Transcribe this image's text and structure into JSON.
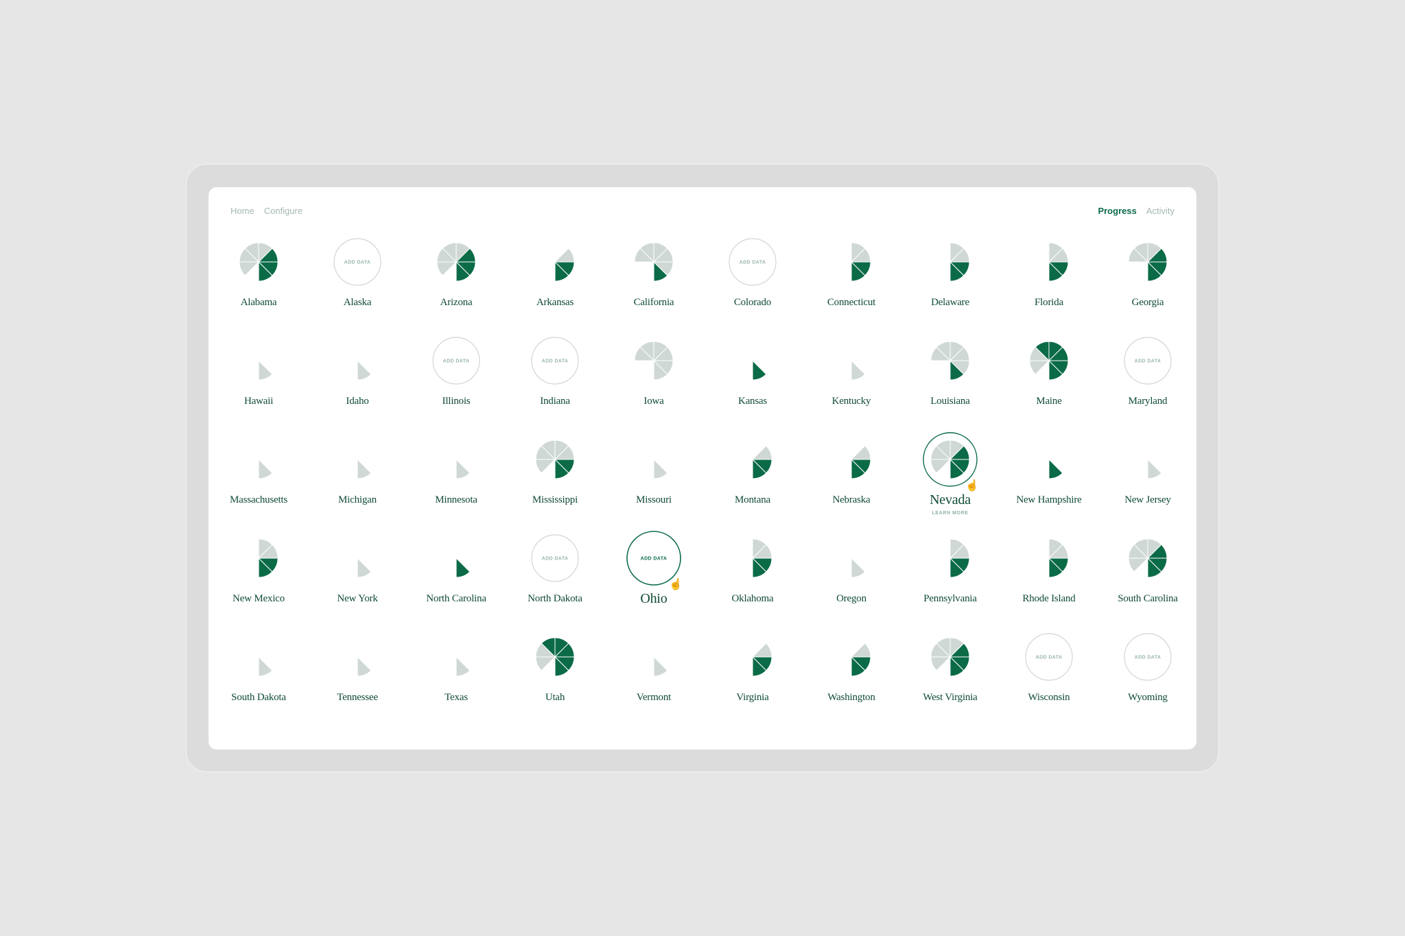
{
  "nav": {
    "left": [
      {
        "label": "Home",
        "active": false
      },
      {
        "label": "Configure",
        "active": false
      }
    ],
    "right": [
      {
        "label": "Progress",
        "active": true
      },
      {
        "label": "Activity",
        "active": false
      }
    ]
  },
  "colors": {
    "primary": "#0b6b47",
    "muted": "#cfd8d5",
    "text": "#0f4b33",
    "background": "#e6e6e6"
  },
  "add_data_label": "ADD DATA",
  "learn_more_label": "LEARN MORE",
  "chart_note": "Each state shows an 8-segment radial progress icon; muted = light grey, filled = green; null = no data (Add Data button)",
  "states": [
    {
      "name": "Alabama",
      "muted": 4,
      "filled": 3
    },
    {
      "name": "Alaska",
      "muted": null,
      "filled": null
    },
    {
      "name": "Arizona",
      "muted": 4,
      "filled": 3
    },
    {
      "name": "Arkansas",
      "muted": 1,
      "filled": 2
    },
    {
      "name": "California",
      "muted": 5,
      "filled": 1
    },
    {
      "name": "Colorado",
      "muted": null,
      "filled": null
    },
    {
      "name": "Connecticut",
      "muted": 2,
      "filled": 2
    },
    {
      "name": "Delaware",
      "muted": 2,
      "filled": 2
    },
    {
      "name": "Florida",
      "muted": 2,
      "filled": 2
    },
    {
      "name": "Georgia",
      "muted": 3,
      "filled": 3
    },
    {
      "name": "Hawaii",
      "muted": 1,
      "filled": 0
    },
    {
      "name": "Idaho",
      "muted": 1,
      "filled": 0
    },
    {
      "name": "Illinois",
      "muted": null,
      "filled": null
    },
    {
      "name": "Indiana",
      "muted": null,
      "filled": null
    },
    {
      "name": "Iowa",
      "muted": 6,
      "filled": 0
    },
    {
      "name": "Kansas",
      "muted": 0,
      "filled": 1
    },
    {
      "name": "Kentucky",
      "muted": 1,
      "filled": 0
    },
    {
      "name": "Louisiana",
      "muted": 5,
      "filled": 1
    },
    {
      "name": "Maine",
      "muted": 2,
      "filled": 5
    },
    {
      "name": "Maryland",
      "muted": null,
      "filled": null
    },
    {
      "name": "Massachusetts",
      "muted": 1,
      "filled": 0
    },
    {
      "name": "Michigan",
      "muted": 1,
      "filled": 0
    },
    {
      "name": "Minnesota",
      "muted": 1,
      "filled": 0
    },
    {
      "name": "Mississippi",
      "muted": 5,
      "filled": 2
    },
    {
      "name": "Missouri",
      "muted": 1,
      "filled": 0
    },
    {
      "name": "Montana",
      "muted": 1,
      "filled": 2
    },
    {
      "name": "Nebraska",
      "muted": 1,
      "filled": 2
    },
    {
      "name": "Nevada",
      "muted": 4,
      "filled": 3,
      "hovered": true
    },
    {
      "name": "New Hampshire",
      "muted": 0,
      "filled": 1
    },
    {
      "name": "New Jersey",
      "muted": 1,
      "filled": 0
    },
    {
      "name": "New Mexico",
      "muted": 2,
      "filled": 2
    },
    {
      "name": "New York",
      "muted": 1,
      "filled": 0
    },
    {
      "name": "North Carolina",
      "muted": 0,
      "filled": 1
    },
    {
      "name": "North Dakota",
      "muted": null,
      "filled": null
    },
    {
      "name": "Ohio",
      "muted": null,
      "filled": null,
      "hovered": true
    },
    {
      "name": "Oklahoma",
      "muted": 2,
      "filled": 2
    },
    {
      "name": "Oregon",
      "muted": 1,
      "filled": 0
    },
    {
      "name": "Pennsylvania",
      "muted": 2,
      "filled": 2
    },
    {
      "name": "Rhode Island",
      "muted": 2,
      "filled": 2
    },
    {
      "name": "South Carolina",
      "muted": 4,
      "filled": 3
    },
    {
      "name": "South Dakota",
      "muted": 1,
      "filled": 0
    },
    {
      "name": "Tennessee",
      "muted": 1,
      "filled": 0
    },
    {
      "name": "Texas",
      "muted": 1,
      "filled": 0
    },
    {
      "name": "Utah",
      "muted": 2,
      "filled": 5
    },
    {
      "name": "Vermont",
      "muted": 1,
      "filled": 0
    },
    {
      "name": "Virginia",
      "muted": 1,
      "filled": 2
    },
    {
      "name": "Washington",
      "muted": 1,
      "filled": 2
    },
    {
      "name": "West Virginia",
      "muted": 4,
      "filled": 3
    },
    {
      "name": "Wisconsin",
      "muted": null,
      "filled": null
    },
    {
      "name": "Wyoming",
      "muted": null,
      "filled": null
    }
  ]
}
